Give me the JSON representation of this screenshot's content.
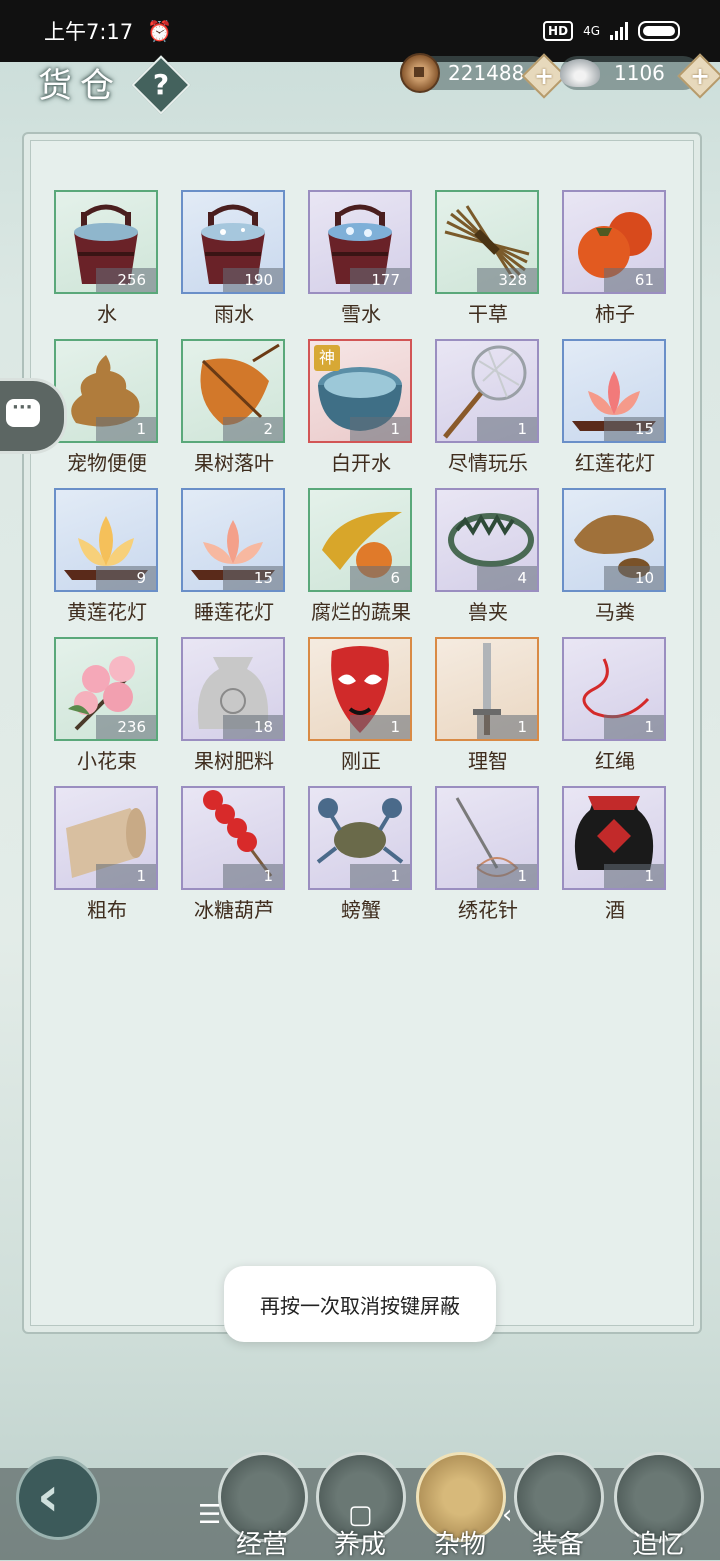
{
  "status": {
    "time": "上午7:17",
    "hd": "HD",
    "network": "4G"
  },
  "header": {
    "title": "货仓",
    "help": "?"
  },
  "currency": {
    "coins": "221488",
    "silver": "1106",
    "plus": "+"
  },
  "items": [
    {
      "name": "水",
      "count": "256",
      "rarity": "green",
      "icon": "bucket-water"
    },
    {
      "name": "雨水",
      "count": "190",
      "rarity": "blue",
      "icon": "bucket-rain"
    },
    {
      "name": "雪水",
      "count": "177",
      "rarity": "purple",
      "icon": "bucket-snow"
    },
    {
      "name": "干草",
      "count": "328",
      "rarity": "green",
      "icon": "hay"
    },
    {
      "name": "柿子",
      "count": "61",
      "rarity": "purple",
      "icon": "persimmon"
    },
    {
      "name": "宠物便便",
      "count": "1",
      "rarity": "green",
      "icon": "poop"
    },
    {
      "name": "果树落叶",
      "count": "2",
      "rarity": "green",
      "icon": "leaf"
    },
    {
      "name": "白开水",
      "count": "1",
      "rarity": "red",
      "icon": "bowl",
      "badge": "神"
    },
    {
      "name": "尽情玩乐",
      "count": "1",
      "rarity": "purple",
      "icon": "net"
    },
    {
      "name": "红莲花灯",
      "count": "15",
      "rarity": "blue",
      "icon": "lotus-red"
    },
    {
      "name": "黄莲花灯",
      "count": "9",
      "rarity": "blue",
      "icon": "lotus-yellow"
    },
    {
      "name": "睡莲花灯",
      "count": "15",
      "rarity": "blue",
      "icon": "lotus-pink"
    },
    {
      "name": "腐烂的蔬果",
      "count": "6",
      "rarity": "green",
      "icon": "rotten-fruit"
    },
    {
      "name": "兽夹",
      "count": "4",
      "rarity": "purple",
      "icon": "trap"
    },
    {
      "name": "马粪",
      "count": "10",
      "rarity": "blue",
      "icon": "dung"
    },
    {
      "name": "小花束",
      "count": "236",
      "rarity": "green",
      "icon": "flowers"
    },
    {
      "name": "果树肥料",
      "count": "18",
      "rarity": "purple",
      "icon": "fertilizer"
    },
    {
      "name": "刚正",
      "count": "1",
      "rarity": "orange",
      "icon": "opera-mask"
    },
    {
      "name": "理智",
      "count": "1",
      "rarity": "orange",
      "icon": "sword"
    },
    {
      "name": "红绳",
      "count": "1",
      "rarity": "purple",
      "icon": "red-rope"
    },
    {
      "name": "粗布",
      "count": "1",
      "rarity": "purple",
      "icon": "cloth"
    },
    {
      "name": "冰糖葫芦",
      "count": "1",
      "rarity": "purple",
      "icon": "candied-haws"
    },
    {
      "name": "螃蟹",
      "count": "1",
      "rarity": "purple",
      "icon": "crab"
    },
    {
      "name": "绣花针",
      "count": "1",
      "rarity": "purple",
      "icon": "needle"
    },
    {
      "name": "酒",
      "count": "1",
      "rarity": "purple",
      "icon": "wine-jar"
    }
  ],
  "toast": "再按一次取消按键屏蔽",
  "tabs": [
    "经营",
    "养成",
    "杂物",
    "装备",
    "追忆"
  ],
  "active_tab": "杂物"
}
